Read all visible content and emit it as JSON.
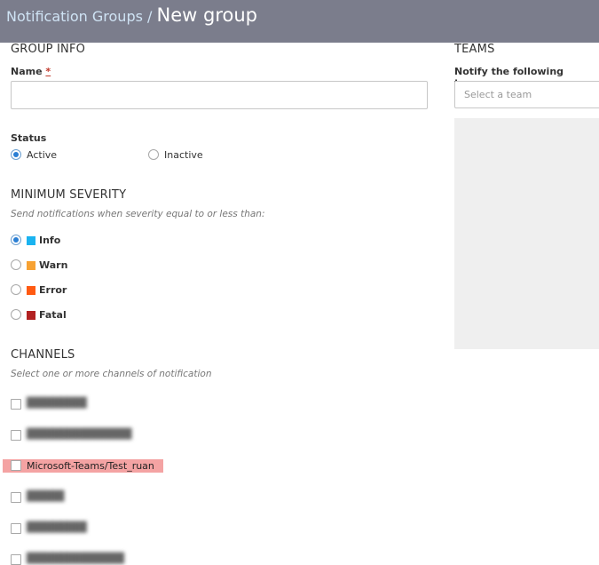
{
  "header": {
    "breadcrumb": "Notification Groups /",
    "title": "New group"
  },
  "group_info": {
    "title": "GROUP INFO",
    "name_label": "Name",
    "required_mark": "*",
    "name_value": "",
    "status_label": "Status",
    "status_options": [
      {
        "label": "Active",
        "selected": true
      },
      {
        "label": "Inactive",
        "selected": false
      }
    ]
  },
  "severity": {
    "title": "MINIMUM SEVERITY",
    "hint": "Send notifications when severity equal to or less than:",
    "options": [
      {
        "label": "Info",
        "color": "#1ab3f0",
        "selected": true
      },
      {
        "label": "Warn",
        "color": "#f7a233",
        "selected": false
      },
      {
        "label": "Error",
        "color": "#ff5a12",
        "selected": false
      },
      {
        "label": "Fatal",
        "color": "#b22222",
        "selected": false
      }
    ]
  },
  "channels": {
    "title": "CHANNELS",
    "hint": "Select one or more channels of notification",
    "items": [
      {
        "label": "████████",
        "checked": false
      },
      {
        "label": "██████████████",
        "checked": false
      },
      {
        "label": "Microsoft-Teams/Test_ruan",
        "checked": false,
        "highlighted": true
      },
      {
        "label": "█████",
        "checked": false
      },
      {
        "label": "████████",
        "checked": false
      },
      {
        "label": "█████████████",
        "checked": false
      }
    ]
  },
  "teams": {
    "title": "TEAMS",
    "label": "Notify the following teams:",
    "placeholder": "Select a team"
  }
}
